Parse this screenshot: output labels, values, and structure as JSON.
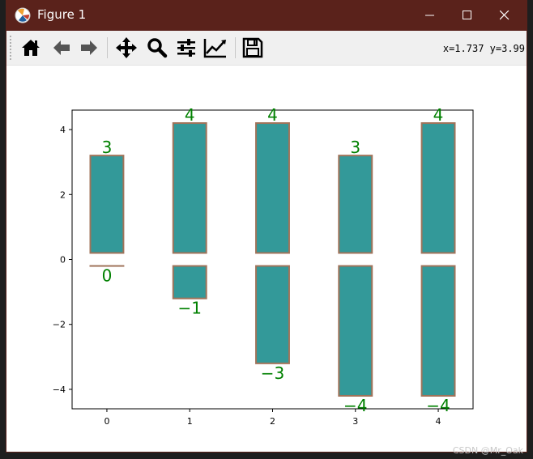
{
  "window": {
    "title": "Figure 1",
    "coords_readout": "x=1.737 y=3.99"
  },
  "toolbar": {
    "tools": [
      {
        "name": "home-icon"
      },
      {
        "name": "back-arrow-icon"
      },
      {
        "name": "forward-arrow-icon"
      },
      {
        "name": "pan-move-icon"
      },
      {
        "name": "zoom-magnifier-icon"
      },
      {
        "name": "subplots-config-icon"
      },
      {
        "name": "axes-edit-icon"
      },
      {
        "name": "save-floppy-icon"
      }
    ]
  },
  "watermark": "CSDN @Mr_Oak",
  "colors": {
    "titlebar": "#5a221b",
    "bar_face": "#339999",
    "bar_edge": "#a0735a",
    "label": "#008000"
  },
  "chart_data": {
    "type": "bar",
    "categories": [
      "0",
      "1",
      "2",
      "3",
      "4"
    ],
    "x": [
      0,
      1,
      2,
      3,
      4
    ],
    "series": [
      {
        "values": [
          3,
          4,
          4,
          3,
          4
        ],
        "bottom": 0.2,
        "labels": [
          "3",
          "4",
          "4",
          "3",
          "4"
        ]
      },
      {
        "values": [
          0,
          -1,
          -3,
          -4,
          -4
        ],
        "bottom": -0.2,
        "labels": [
          "0",
          "−1",
          "−3",
          "−4",
          "−4"
        ]
      }
    ],
    "ylim": [
      -4.6,
      4.6
    ],
    "xlim": [
      -0.42,
      4.42
    ],
    "yticks": [
      -4,
      -2,
      0,
      2,
      4
    ],
    "ytick_labels": [
      "−4",
      "−2",
      "0",
      "2",
      "4"
    ],
    "xtick_labels": [
      "0",
      "1",
      "2",
      "3",
      "4"
    ],
    "bar_width": 0.4,
    "grid": false
  }
}
